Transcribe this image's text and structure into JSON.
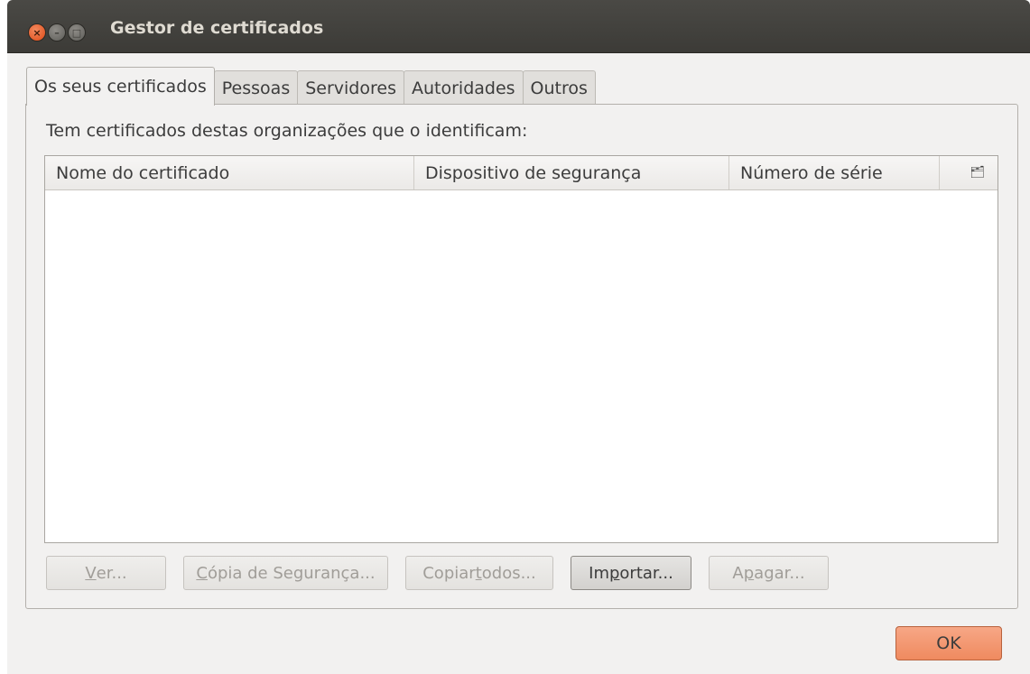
{
  "window": {
    "title": "Gestor de certificados"
  },
  "tabs": [
    {
      "label": "Os seus certificados",
      "active": true
    },
    {
      "label": "Pessoas",
      "active": false
    },
    {
      "label": "Servidores",
      "active": false
    },
    {
      "label": "Autoridades",
      "active": false
    },
    {
      "label": "Outros",
      "active": false
    }
  ],
  "panel": {
    "description": "Tem certificados destas organizações que o identificam:",
    "columns": [
      "Nome do certificado",
      "Dispositivo de segurança",
      "Número de série"
    ],
    "column_picker_icon": "column-picker-icon",
    "rows": []
  },
  "actions": {
    "view": {
      "pre": "",
      "ul": "V",
      "post": "er...",
      "enabled": false
    },
    "backup": {
      "pre": "",
      "ul": "C",
      "post": "ópia de Segurança...",
      "enabled": false
    },
    "backup_all": {
      "pre": "Copiar ",
      "ul": "t",
      "post": "odos...",
      "enabled": false
    },
    "import": {
      "pre": "Im",
      "ul": "p",
      "post": "ortar...",
      "enabled": true
    },
    "delete": {
      "pre": "A",
      "ul": "p",
      "post": "agar...",
      "enabled": false
    }
  },
  "ok_label": "OK",
  "colors": {
    "accent": "#ef8a5f",
    "titlebar": "#3c3b37",
    "window_bg": "#f2f1f0"
  }
}
